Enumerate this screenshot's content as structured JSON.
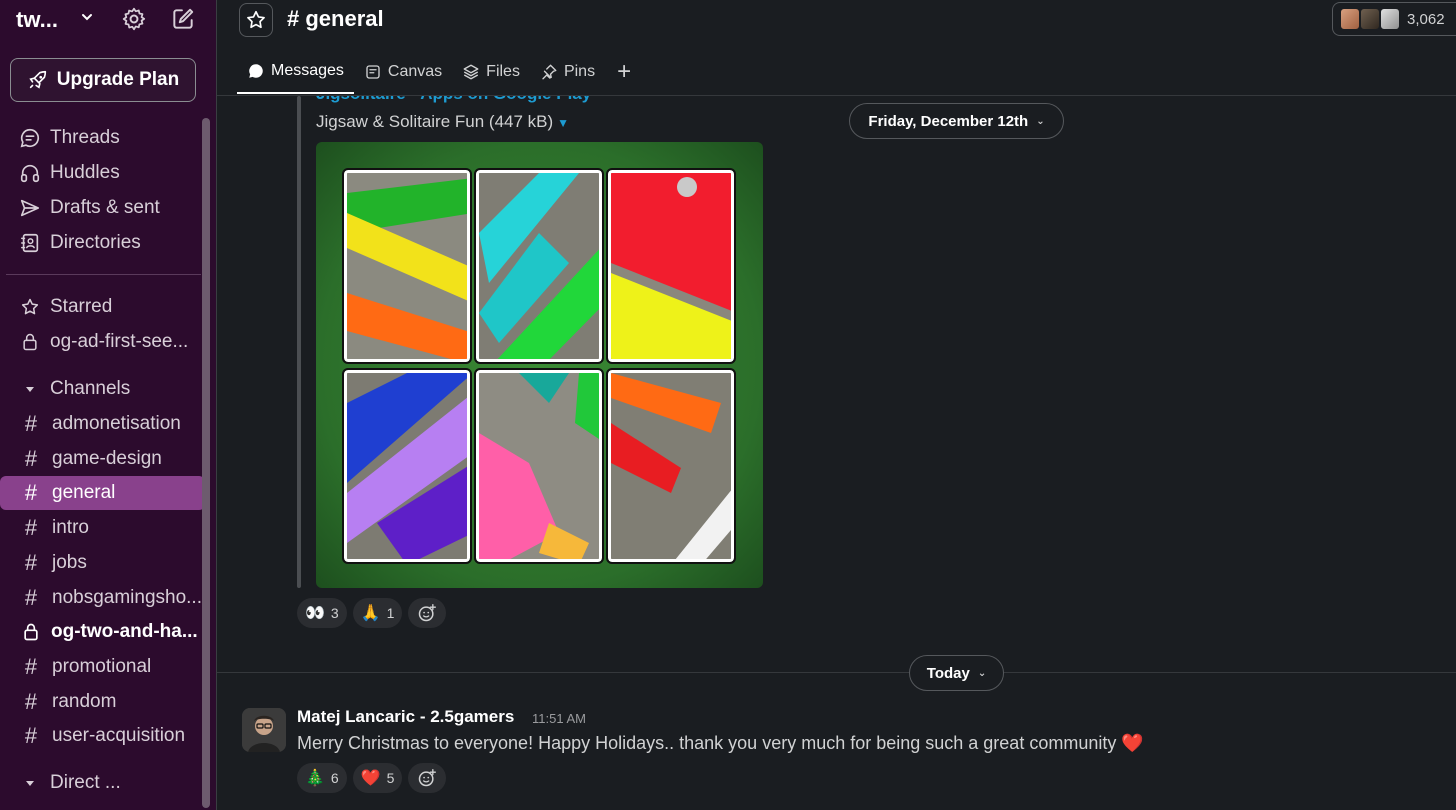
{
  "workspace": {
    "name": "tw...",
    "upgrade_label": "Upgrade Plan"
  },
  "sidebar": {
    "top_items": [
      {
        "label": "Threads",
        "icon": "threads-icon"
      },
      {
        "label": "Huddles",
        "icon": "headphones-icon"
      },
      {
        "label": "Drafts & sent",
        "icon": "send-icon"
      },
      {
        "label": "Directories",
        "icon": "directory-icon"
      }
    ],
    "starred_label": "Starred",
    "starred_items": [
      {
        "label": "og-ad-first-see...",
        "icon": "lock-icon"
      }
    ],
    "channels_label": "Channels",
    "channels": [
      {
        "label": "admonetisation",
        "type": "hash"
      },
      {
        "label": "game-design",
        "type": "hash"
      },
      {
        "label": "general",
        "type": "hash",
        "active": true
      },
      {
        "label": "intro",
        "type": "hash"
      },
      {
        "label": "jobs",
        "type": "hash"
      },
      {
        "label": "nobsgamingsho...",
        "type": "hash"
      },
      {
        "label": "og-two-and-ha...",
        "type": "lock",
        "bold": true
      },
      {
        "label": "promotional",
        "type": "hash"
      },
      {
        "label": "random",
        "type": "hash"
      },
      {
        "label": "user-acquisition",
        "type": "hash"
      }
    ],
    "direct_label": "Direct ..."
  },
  "header": {
    "channel": "general",
    "members_count": "3,062",
    "tabs": [
      "Messages",
      "Canvas",
      "Files",
      "Pins"
    ]
  },
  "attachment": {
    "link_title": "Jigsolitaire - Apps on Google Play",
    "file_label": "Jigsaw & Solitaire Fun (447 kB)"
  },
  "dates": {
    "first": "Friday, December 12th",
    "second": "Today"
  },
  "reactions_1": [
    {
      "emoji": "👀",
      "count": "3"
    },
    {
      "emoji": "🙏",
      "count": "1"
    }
  ],
  "message": {
    "author": "Matej Lancaric - 2.5gamers",
    "time": "11:51 AM",
    "text": "Merry Christmas to everyone! Happy Holidays.. thank you very much for being such a great community",
    "emoji": "❤️"
  },
  "reactions_2": [
    {
      "emoji": "🎄",
      "count": "6"
    },
    {
      "emoji": "❤️",
      "count": "5"
    }
  ],
  "colors": {
    "sidebar_bg": "#2c0b2d",
    "active_item": "#89418c",
    "link": "#1d9bd1",
    "main_bg": "#1a1d21"
  }
}
